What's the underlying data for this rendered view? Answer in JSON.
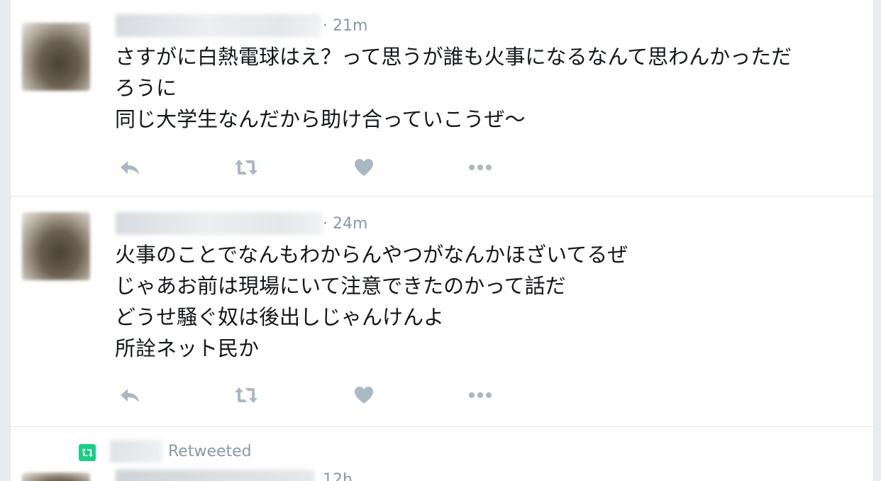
{
  "tweets": [
    {
      "time": "· 21m",
      "lines": [
        "さすがに白熱電球はえ？って思うが誰も火事になるなんて思わんかっただ",
        "ろうに",
        "同じ大学生なんだから助け合っていこうぜ～"
      ]
    },
    {
      "time": "· 24m",
      "lines": [
        "火事のことでなんもわからんやつがなんかほざいてるぜ",
        "じゃあお前は現場にいて注意できたのかって話だ",
        "どうせ騒ぐ奴は後出しじゃんけんよ",
        "所詮ネット民か"
      ]
    }
  ],
  "retweet_row": {
    "label": "Retweeted",
    "partial_time": "12h"
  },
  "icons": {
    "reply": "reply-icon",
    "retweet": "retweet-icon",
    "like": "heart-icon",
    "more": "more-icon",
    "retweeted_badge": "retweeted-badge-icon"
  },
  "colors": {
    "icon_gray": "#aab8c2",
    "meta_gray": "#8899a6",
    "retweet_green": "#19cf86",
    "text": "#14171a",
    "divider": "#e1e8ed"
  }
}
